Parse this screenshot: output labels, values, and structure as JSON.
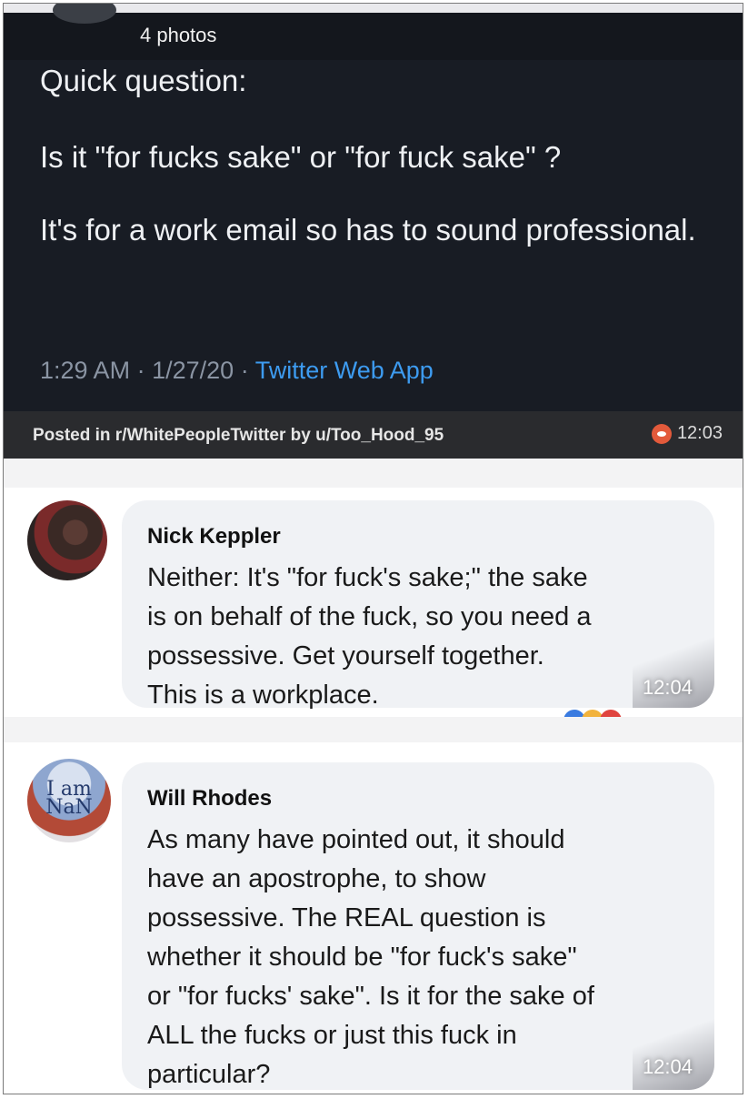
{
  "tweet": {
    "photos_label": "4 photos",
    "line1": "Quick question:",
    "line2": "Is it \"for fucks sake\" or \"for fuck sake\" ?",
    "line3": "It's for a work email so has to sound professional.",
    "time": "1:29 AM",
    "date": "1/27/20",
    "source": "Twitter Web App"
  },
  "reddit_bar": {
    "posted_prefix": "Posted in ",
    "subreddit": "r/WhitePeopleTwitter",
    "by": " by ",
    "user": "u/Too_Hood_95",
    "time": "12:03",
    "icon": "reddit-icon"
  },
  "comments": [
    {
      "name": "Nick Keppler",
      "text": "Neither: It's \"for fuck's sake;\" the sake\nis on behalf of the fuck, so you need a\npossessive. Get yourself together.\nThis is a workplace.",
      "time": "12:04"
    },
    {
      "name": "Will Rhodes",
      "avatar_text": "I am NaN",
      "text": "As many have pointed out, it should\nhave an apostrophe, to show\npossessive. The REAL question is\nwhether it should be \"for fuck's sake\"\nor \"for fucks' sake\". Is it for the sake of\nALL the fucks or just this fuck in\nparticular?",
      "time": "12:04"
    }
  ],
  "colors": {
    "tweet_bg": "#181c24",
    "link_blue": "#3d9bf0",
    "reddit_orange": "#e35a3b",
    "bubble_bg": "#f0f2f5"
  }
}
